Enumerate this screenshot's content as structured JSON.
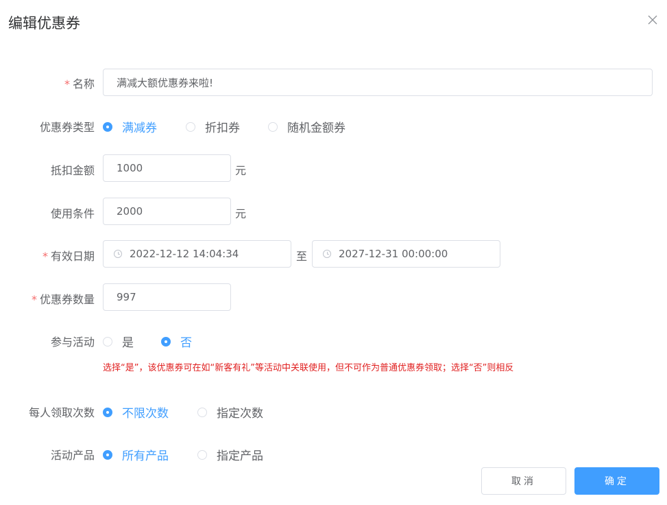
{
  "dialog": {
    "title": "编辑优惠券"
  },
  "form": {
    "name": {
      "label": "名称",
      "value": "满减大额优惠券来啦!"
    },
    "coupon_type": {
      "label": "优惠券类型",
      "options": [
        "满减券",
        "折扣券",
        "随机金额券"
      ],
      "selected": "满减券"
    },
    "discount_amount": {
      "label": "抵扣金额",
      "value": "1000",
      "unit": "元"
    },
    "use_condition": {
      "label": "使用条件",
      "value": "2000",
      "unit": "元"
    },
    "valid_date": {
      "label": "有效日期",
      "start": "2022-12-12 14:04:34",
      "separator": "至",
      "end": "2027-12-31 00:00:00"
    },
    "quantity": {
      "label": "优惠券数量",
      "value": "997"
    },
    "join_activity": {
      "label": "参与活动",
      "options": [
        "是",
        "否"
      ],
      "selected": "否",
      "hint": "选择“是”，该优惠券可在如“新客有礼”等活动中关联使用，但不可作为普通优惠券领取；选择“否”则相反"
    },
    "claim_limit": {
      "label": "每人领取次数",
      "options": [
        "不限次数",
        "指定次数"
      ],
      "selected": "不限次数"
    },
    "products": {
      "label": "活动产品",
      "options": [
        "所有产品",
        "指定产品"
      ],
      "selected": "所有产品"
    }
  },
  "footer": {
    "cancel_label": "取消",
    "confirm_label": "确定"
  },
  "colors": {
    "primary": "#409eff",
    "required": "#f56c6c",
    "hint": "#e02020"
  }
}
